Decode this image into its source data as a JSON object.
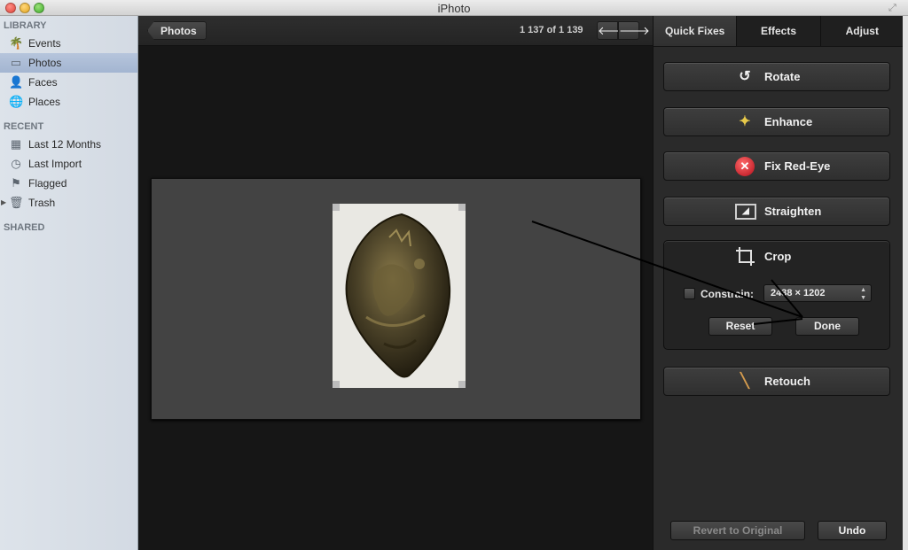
{
  "window": {
    "title": "iPhoto"
  },
  "sidebar": {
    "library_header": "LIBRARY",
    "library_items": [
      {
        "label": "Events",
        "icon": "palm-tree-icon"
      },
      {
        "label": "Photos",
        "icon": "photo-icon"
      },
      {
        "label": "Faces",
        "icon": "person-icon"
      },
      {
        "label": "Places",
        "icon": "globe-icon"
      }
    ],
    "recent_header": "RECENT",
    "recent_items": [
      {
        "label": "Last 12 Months",
        "icon": "calendar-icon"
      },
      {
        "label": "Last Import",
        "icon": "clock-icon"
      },
      {
        "label": "Flagged",
        "icon": "flag-icon"
      },
      {
        "label": "Trash",
        "icon": "trash-icon"
      }
    ],
    "shared_header": "SHARED",
    "selected": "Photos"
  },
  "viewer": {
    "back_label": "Photos",
    "count_label": "1 137 of 1 139"
  },
  "panel": {
    "tabs": [
      "Quick Fixes",
      "Effects",
      "Adjust"
    ],
    "active_tab": "Quick Fixes",
    "buttons": {
      "rotate": "Rotate",
      "enhance": "Enhance",
      "fix_red_eye": "Fix Red-Eye",
      "straighten": "Straighten",
      "retouch": "Retouch"
    },
    "crop": {
      "title": "Crop",
      "constrain_label": "Constrain:",
      "constrain_checked": false,
      "constrain_value": "2438 × 1202",
      "reset_label": "Reset",
      "done_label": "Done"
    },
    "revert_label": "Revert to Original",
    "undo_label": "Undo"
  },
  "colors": {
    "selection": "#a9b9d4",
    "panel_bg": "#2a2a2a",
    "viewer_bg": "#161616"
  }
}
